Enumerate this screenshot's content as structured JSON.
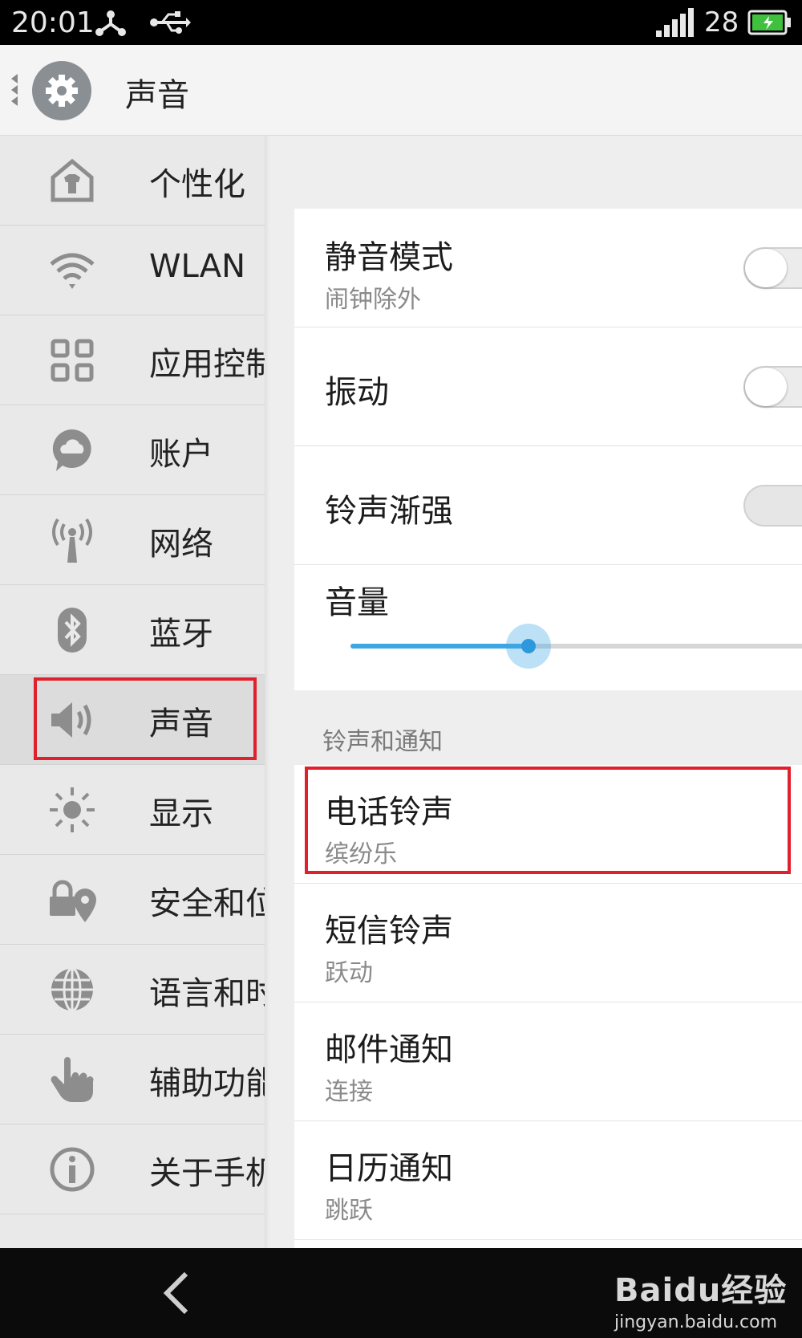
{
  "status_bar": {
    "time": "20:01",
    "battery_level": "28",
    "icons": [
      "share-icon",
      "usb-icon",
      "signal-icon",
      "battery-icon"
    ]
  },
  "header": {
    "title": "声音",
    "icon": "gear-icon"
  },
  "sidebar": {
    "items": [
      {
        "label": "个性化",
        "icon": "theme-icon"
      },
      {
        "label": "WLAN",
        "icon": "wifi-icon"
      },
      {
        "label": "应用控制",
        "icon": "apps-grid-icon"
      },
      {
        "label": "账户",
        "icon": "cloud-account-icon"
      },
      {
        "label": "网络",
        "icon": "antenna-icon"
      },
      {
        "label": "蓝牙",
        "icon": "bluetooth-icon"
      },
      {
        "label": "声音",
        "icon": "speaker-icon",
        "active": true
      },
      {
        "label": "显示",
        "icon": "brightness-icon"
      },
      {
        "label": "安全和位置",
        "icon": "lock-location-icon"
      },
      {
        "label": "语言和时间",
        "icon": "globe-icon"
      },
      {
        "label": "辅助功能",
        "icon": "hand-icon"
      },
      {
        "label": "关于手机",
        "icon": "info-icon"
      }
    ]
  },
  "settings": {
    "silent_mode": {
      "title": "静音模式",
      "subtitle": "闹钟除外",
      "enabled": false
    },
    "vibrate": {
      "title": "振动",
      "enabled": false
    },
    "ring_crescendo": {
      "title": "铃声渐强",
      "enabled": false
    },
    "volume": {
      "title": "音量",
      "level_fraction": 0.39
    },
    "section_ringtones": "铃声和通知",
    "ringtones": [
      {
        "title": "电话铃声",
        "value": "缤纷乐"
      },
      {
        "title": "短信铃声",
        "value": "跃动"
      },
      {
        "title": "邮件通知",
        "value": "连接"
      },
      {
        "title": "日历通知",
        "value": "跳跃"
      }
    ]
  },
  "watermark": {
    "brand": "Baidu经验",
    "url": "jingyan.baidu.com"
  },
  "colors": {
    "accent": "#3fa6e4",
    "highlight": "#e0202c"
  }
}
